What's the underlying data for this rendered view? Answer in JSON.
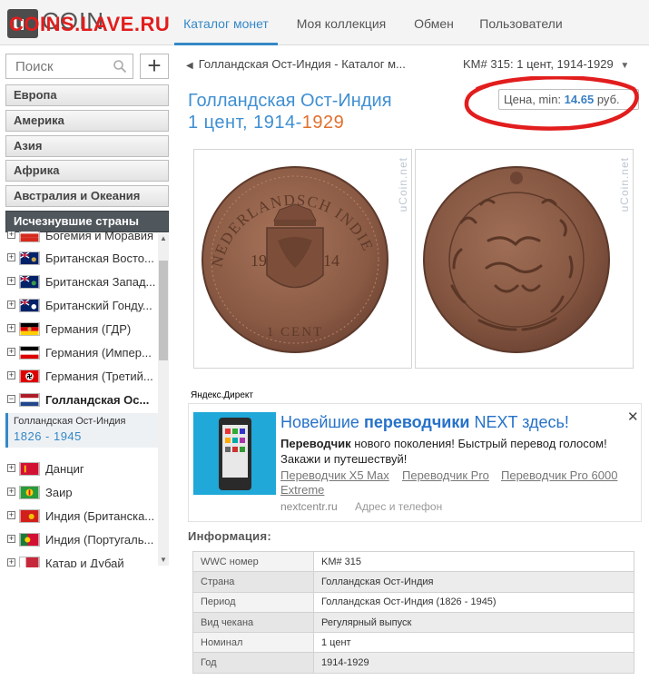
{
  "watermark": "COINS.LAVE.RU",
  "logo": {
    "icon_letter": "u",
    "text": "COIN"
  },
  "nav": {
    "tabs": [
      {
        "label": "Каталог монет",
        "active": true
      },
      {
        "label": "Моя коллекция",
        "active": false
      },
      {
        "label": "Обмен",
        "active": false
      },
      {
        "label": "Пользователи",
        "active": false
      }
    ]
  },
  "sidebar": {
    "search_placeholder": "Поиск",
    "add_label": "+",
    "regions": [
      {
        "label": "Европа",
        "active": false
      },
      {
        "label": "Америка",
        "active": false
      },
      {
        "label": "Азия",
        "active": false
      },
      {
        "label": "Африка",
        "active": false
      },
      {
        "label": "Австралия и Океания",
        "active": false
      },
      {
        "label": "Исчезнувшие страны",
        "active": true
      }
    ],
    "countries": [
      {
        "label": "Богемия и Моравия",
        "expand": "+",
        "flag": "bohemia"
      },
      {
        "label": "Британская Восто...",
        "expand": "+",
        "flag": "blue-ensign"
      },
      {
        "label": "Британская Запад...",
        "expand": "+",
        "flag": "blue-ensign"
      },
      {
        "label": "Британский Гонду...",
        "expand": "+",
        "flag": "blue-ensign"
      },
      {
        "label": "Германия (ГДР)",
        "expand": "+",
        "flag": "gdr"
      },
      {
        "label": "Германия (Импер...",
        "expand": "+",
        "flag": "german-empire"
      },
      {
        "label": "Германия (Третий...",
        "expand": "+",
        "flag": "third-reich"
      },
      {
        "label": "Голландская Ос...",
        "expand": "−",
        "flag": "netherlands",
        "selected": true
      },
      {
        "label": "Данциг",
        "expand": "+",
        "flag": "danzig"
      },
      {
        "label": "Заир",
        "expand": "+",
        "flag": "zaire"
      },
      {
        "label": "Индия (Британска...",
        "expand": "+",
        "flag": "india-british"
      },
      {
        "label": "Индия (Португаль...",
        "expand": "+",
        "flag": "portugal"
      },
      {
        "label": "Катар и Дубай",
        "expand": "+",
        "flag": "qatar"
      }
    ],
    "selected_period": {
      "name": "Голландская Ост-Индия",
      "years": "1826 - 1945"
    }
  },
  "main": {
    "breadcrumb": "Голландская Ост-Индия - Каталог м...",
    "km_select": "KM# 315: 1 цент, 1914-1929",
    "title": "Голландская Ост-Индия",
    "subtitle_prefix": "1 цент, 1914-",
    "subtitle_end_year": "1929",
    "price_label": "Цена, min:",
    "price_value": "14.65",
    "price_unit": "руб.",
    "coin_watermark": "uCoin.net",
    "obverse_legend": "NEDERLANDSCH INDIE",
    "obverse_year_left": "19",
    "obverse_year_right": "14",
    "obverse_denomination": "1 CENT"
  },
  "ad": {
    "yandex_label": "Яндекс.Директ",
    "title_pre": "Новейшие ",
    "title_bold": "переводчики",
    "title_post": " NEXT здесь!",
    "text_bold": "Переводчик",
    "text_rest": " нового поколения! Быстрый перевод голосом! Закажи и путешествуй!",
    "links": [
      "Переводчик X5 Max",
      "Переводчик Pro",
      "Переводчик Pro 6000"
    ],
    "link_wrap": "Extreme",
    "domain": "nextcentr.ru",
    "address": "Адрес и телефон",
    "close": "✕"
  },
  "info": {
    "heading": "Информация:",
    "rows": [
      {
        "key": "WWC номер",
        "value": "KM# 315"
      },
      {
        "key": "Страна",
        "value": "Голландская Ост-Индия"
      },
      {
        "key": "Период",
        "value": "Голландская Ост-Индия (1826 - 1945)"
      },
      {
        "key": "Вид чекана",
        "value": "Регулярный выпуск"
      },
      {
        "key": "Номинал",
        "value": "1 цент"
      },
      {
        "key": "Год",
        "value": "1914-1929"
      }
    ]
  },
  "colors": {
    "accent": "#3f8fd2",
    "highlight": "#e21d1d",
    "year_accent": "#e0702e",
    "copper": "#8a5a44"
  }
}
